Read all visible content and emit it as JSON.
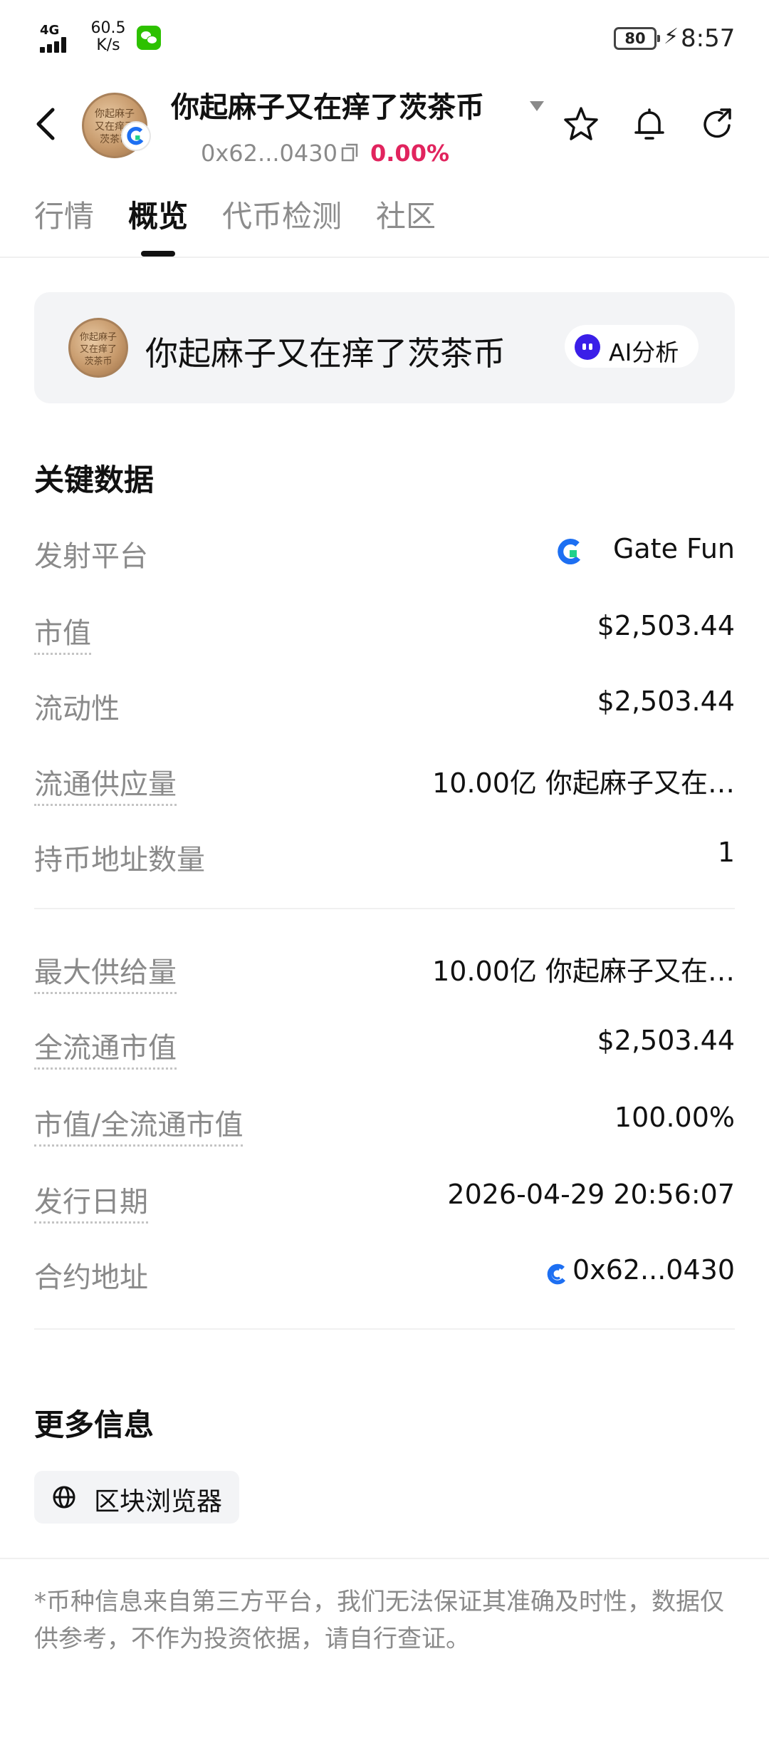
{
  "status_bar": {
    "network": "4G",
    "speed_value": "60.5",
    "speed_unit": "K/s",
    "battery": "80",
    "time": "8:57"
  },
  "header": {
    "title": "你起麻子又在痒了茨茶币",
    "address": "0x62...0430",
    "change_pct": "0.00%",
    "change_color": "#e1245e",
    "avatar_text": "你起麻子又在痒了茨茶币"
  },
  "tabs": [
    "行情",
    "概览",
    "代币检测",
    "社区"
  ],
  "active_tab": "概览",
  "card": {
    "name": "你起麻子又在痒了茨茶币",
    "ai_label": "AI分析"
  },
  "key_data": {
    "title": "关键数据",
    "rows": [
      {
        "label": "发射平台",
        "value": "Gate Fun"
      },
      {
        "label": "市值",
        "value": "$2,503.44"
      },
      {
        "label": "流动性",
        "value": "$2,503.44"
      },
      {
        "label": "流通供应量",
        "value": "10.00亿 你起麻子又在…"
      },
      {
        "label": "持币地址数量",
        "value": "1"
      },
      {
        "label": "最大供给量",
        "value": "10.00亿 你起麻子又在…"
      },
      {
        "label": "全流通市值",
        "value": "$2,503.44"
      },
      {
        "label": "市值/全流通市值",
        "value": "100.00%"
      },
      {
        "label": "发行日期",
        "value": "2026-04-29 20:56:07"
      },
      {
        "label": "合约地址",
        "value": "0x62...0430"
      }
    ]
  },
  "more_info": {
    "title": "更多信息",
    "explorer_label": "区块浏览器"
  },
  "disclaimer": "*币种信息来自第三方平台，我们无法保证其准确及时性，数据仅供参考，不作为投资依据，请自行查证。",
  "colors": {
    "accent_red": "#e1245e",
    "gate_blue": "#1d6ff2",
    "gate_green": "#1ed18b",
    "ai_purple": "#3a1ee8"
  }
}
